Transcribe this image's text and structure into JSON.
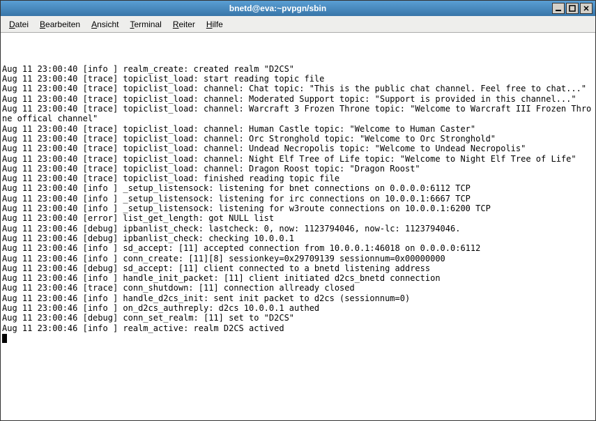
{
  "window": {
    "title": "bnetd@eva:~pvpgn/sbin"
  },
  "menu": {
    "items": [
      {
        "label": "Datei",
        "accel": 0
      },
      {
        "label": "Bearbeiten",
        "accel": 0
      },
      {
        "label": "Ansicht",
        "accel": 0
      },
      {
        "label": "Terminal",
        "accel": 0
      },
      {
        "label": "Reiter",
        "accel": 0
      },
      {
        "label": "Hilfe",
        "accel": 0
      }
    ]
  },
  "log_lines": [
    "Aug 11 23:00:40 [info ] realm_create: created realm \"D2CS\"",
    "Aug 11 23:00:40 [trace] topiclist_load: start reading topic file",
    "Aug 11 23:00:40 [trace] topiclist_load: channel: Chat topic: \"This is the public chat channel. Feel free to chat...\"",
    "Aug 11 23:00:40 [trace] topiclist_load: channel: Moderated Support topic: \"Support is provided in this channel...\"",
    "Aug 11 23:00:40 [trace] topiclist_load: channel: Warcraft 3 Frozen Throne topic: \"Welcome to Warcraft III Frozen Throne offical channel\"",
    "Aug 11 23:00:40 [trace] topiclist_load: channel: Human Castle topic: \"Welcome to Human Caster\"",
    "Aug 11 23:00:40 [trace] topiclist_load: channel: Orc Stronghold topic: \"Welcome to Orc Stronghold\"",
    "Aug 11 23:00:40 [trace] topiclist_load: channel: Undead Necropolis topic: \"Welcome to Undead Necropolis\"",
    "Aug 11 23:00:40 [trace] topiclist_load: channel: Night Elf Tree of Life topic: \"Welcome to Night Elf Tree of Life\"",
    "Aug 11 23:00:40 [trace] topiclist_load: channel: Dragon Roost topic: \"Dragon Roost\"",
    "Aug 11 23:00:40 [trace] topiclist_load: finished reading topic file",
    "Aug 11 23:00:40 [info ] _setup_listensock: listening for bnet connections on 0.0.0.0:6112 TCP",
    "Aug 11 23:00:40 [info ] _setup_listensock: listening for irc connections on 10.0.0.1:6667 TCP",
    "Aug 11 23:00:40 [info ] _setup_listensock: listening for w3route connections on 10.0.0.1:6200 TCP",
    "Aug 11 23:00:40 [error] list_get_length: got NULL list",
    "Aug 11 23:00:46 [debug] ipbanlist_check: lastcheck: 0, now: 1123794046, now-lc: 1123794046.",
    "Aug 11 23:00:46 [debug] ipbanlist_check: checking 10.0.0.1",
    "Aug 11 23:00:46 [info ] sd_accept: [11] accepted connection from 10.0.0.1:46018 on 0.0.0.0:6112",
    "Aug 11 23:00:46 [info ] conn_create: [11][8] sessionkey=0x29709139 sessionnum=0x00000000",
    "Aug 11 23:00:46 [debug] sd_accept: [11] client connected to a bnetd listening address",
    "Aug 11 23:00:46 [info ] handle_init_packet: [11] client initiated d2cs_bnetd connection",
    "Aug 11 23:00:46 [trace] conn_shutdown: [11] connection allready closed",
    "Aug 11 23:00:46 [info ] handle_d2cs_init: sent init packet to d2cs (sessionnum=0)",
    "Aug 11 23:00:46 [info ] on_d2cs_authreply: d2cs 10.0.0.1 authed",
    "Aug 11 23:00:46 [debug] conn_set_realm: [11] set to \"D2CS\"",
    "Aug 11 23:00:46 [info ] realm_active: realm D2CS actived"
  ]
}
